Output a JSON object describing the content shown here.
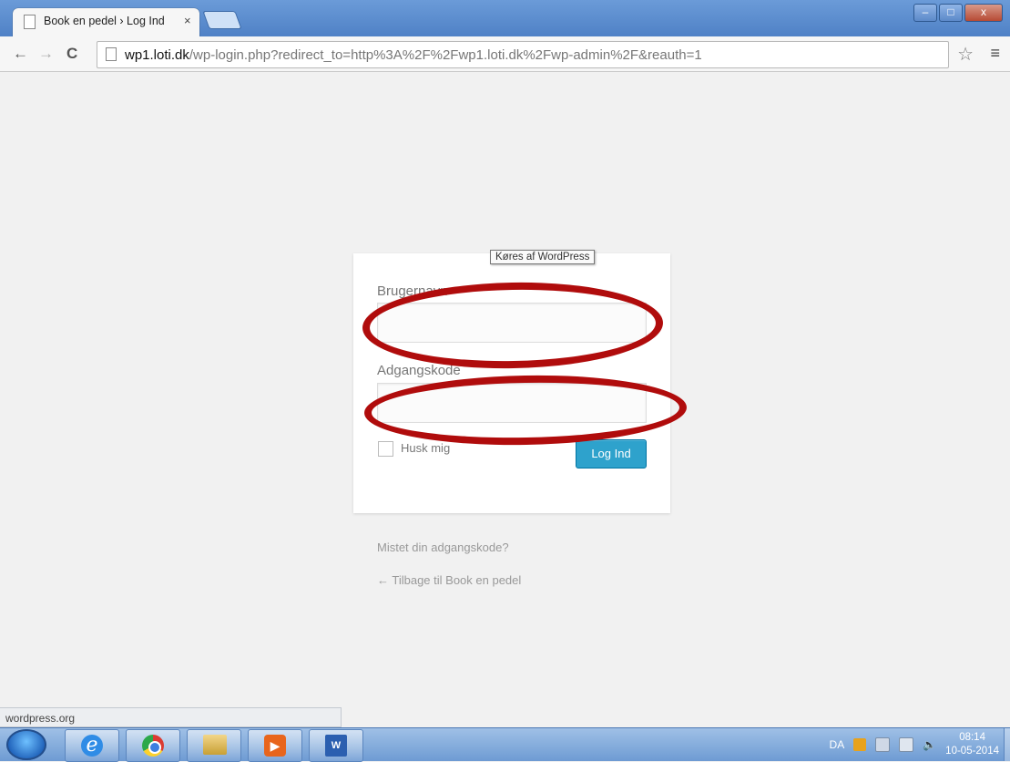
{
  "browser": {
    "tab_title": "Book en pedel › Log Ind",
    "tab_close": "×",
    "url_host": "wp1.loti.dk",
    "url_path": "/wp-login.php?redirect_to=http%3A%2F%2Fwp1.loti.dk%2Fwp-admin%2F&reauth=1",
    "back_icon": "←",
    "forward_icon": "→",
    "reload_icon": "C",
    "star_icon": "☆",
    "menu_icon": "≡",
    "window_controls": {
      "minimize": "–",
      "maximize": "□",
      "close": "x"
    }
  },
  "login": {
    "tooltip": "Køres af WordPress",
    "username_label": "Brugernavn",
    "username_value": "",
    "password_label": "Adgangskode",
    "password_value": "",
    "remember_label": "Husk mig",
    "submit_label": "Log Ind",
    "lost_password": "Mistet din adgangskode?",
    "back_to_blog": "← Tilbage til Book en pedel"
  },
  "status_bar": {
    "text": "wordpress.org"
  },
  "taskbar": {
    "ie_glyph": "e",
    "word_glyph": "W",
    "media_glyph": "▶",
    "language": "DA",
    "time": "08:14",
    "date": "10-05-2014"
  },
  "colors": {
    "annotation": "#b00c0c",
    "primary_button": "#2ea2cc",
    "page_background": "#f1f1f1"
  }
}
